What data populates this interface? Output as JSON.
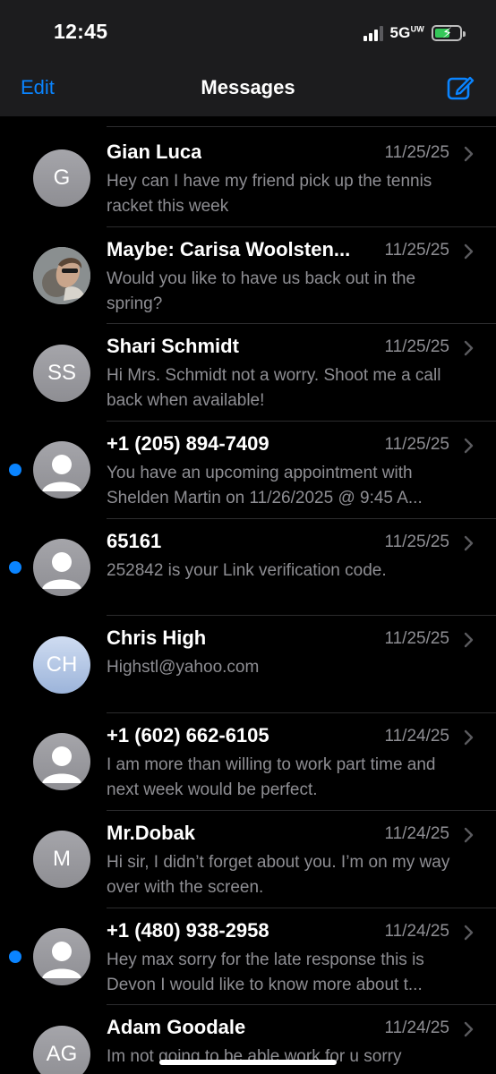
{
  "status": {
    "time": "12:45",
    "network": "5G",
    "network_suffix": "UW",
    "battery_charging": true
  },
  "nav": {
    "edit_label": "Edit",
    "title": "Messages",
    "compose_icon": "compose-icon"
  },
  "colors": {
    "accent": "#0a84ff",
    "secondary_text": "#8e8e93",
    "background": "#000000"
  },
  "conversations": [
    {
      "name": "Gian Luca",
      "date": "11/25/25",
      "preview": "Hey can I have my friend pick up the tennis racket this week",
      "avatar": {
        "type": "initials",
        "text": "G"
      },
      "unread": false
    },
    {
      "name": "Maybe: Carisa Woolsten...",
      "date": "11/25/25",
      "preview": "Would you like to have us back out in the spring?",
      "avatar": {
        "type": "photo"
      },
      "unread": false
    },
    {
      "name": "Shari Schmidt",
      "date": "11/25/25",
      "preview": "Hi Mrs. Schmidt not a worry. Shoot me a call back when available!",
      "avatar": {
        "type": "initials",
        "text": "SS"
      },
      "unread": false
    },
    {
      "name": "+1 (205) 894-7409",
      "date": "11/25/25",
      "preview": "You have an upcoming appointment with Shelden Martin on 11/26/2025 @ 9:45 A...",
      "avatar": {
        "type": "silhouette"
      },
      "unread": true
    },
    {
      "name": "65161",
      "date": "11/25/25",
      "preview": "252842 is your Link verification code.",
      "avatar": {
        "type": "silhouette"
      },
      "unread": true
    },
    {
      "name": "Chris High",
      "date": "11/25/25",
      "preview": "Highstl@yahoo.com",
      "avatar": {
        "type": "initials",
        "text": "CH",
        "style": "blue"
      },
      "unread": false
    },
    {
      "name": "+1 (602) 662-6105",
      "date": "11/24/25",
      "preview": "I am more than willing to work part time and next week would be perfect.",
      "avatar": {
        "type": "silhouette"
      },
      "unread": false
    },
    {
      "name": "Mr.Dobak",
      "date": "11/24/25",
      "preview": "Hi sir, I didn’t forget about you. I’m on my way over with the screen.",
      "avatar": {
        "type": "initials",
        "text": "M"
      },
      "unread": false
    },
    {
      "name": "+1 (480) 938-2958",
      "date": "11/24/25",
      "preview": "Hey max sorry for the late response this is Devon I would like to know more about t...",
      "avatar": {
        "type": "silhouette"
      },
      "unread": true
    },
    {
      "name": "Adam Goodale",
      "date": "11/24/25",
      "preview": "Im not going to be able work for u sorry",
      "avatar": {
        "type": "initials",
        "text": "AG"
      },
      "unread": false
    }
  ]
}
